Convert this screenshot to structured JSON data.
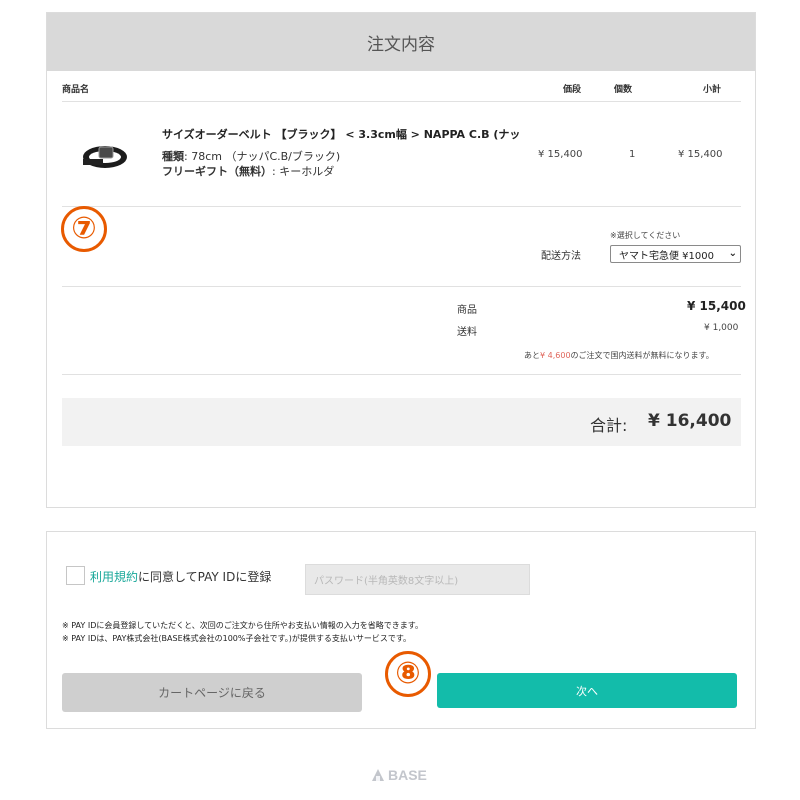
{
  "order": {
    "title": "注文内容",
    "columns": {
      "name": "商品名",
      "price": "価段",
      "qty": "個数",
      "subtotal": "小計"
    },
    "item": {
      "name": "サイズオーダーベルト 【ブラック】 < 3.3cm幅 > NAPPA C.B (ナッ",
      "option1_label": "種類",
      "option1_value": ": 78cm （ナッパC.B/ブラック)",
      "option2_label": "フリーギフト（無料）",
      "option2_value": ": キーホルダ",
      "price": "¥ 15,400",
      "qty": "1",
      "subtotal": "¥ 15,400"
    },
    "step7_marker": "⑦",
    "shipping": {
      "note": "※選択してください",
      "label": "配送方法",
      "selected": "ヤマト宅急便 ¥1000"
    },
    "summary": {
      "goods_label": "商品",
      "goods_value": "¥ 15,400",
      "shipping_label": "送料",
      "shipping_value": "¥ 1,000",
      "free_note_pre": "あと",
      "free_note_amount": "¥ 4,600",
      "free_note_post": "のご注文で国内送料が無料になります。"
    },
    "total_label": "合計:",
    "total_value": "¥ 16,400"
  },
  "register": {
    "terms_link": "利用規約",
    "agree_text": "に同意してPAY IDに登録",
    "password_placeholder": "パスワード(半角英数8文字以上)",
    "notice1": "※ PAY IDに会員登録していただくと、次回のご注文から住所やお支払い情報の入力を省略できます。",
    "notice2": "※ PAY IDは、PAY株式会社(BASE株式会社の100%子会社です。)が提供する支払いサービスです。",
    "back_label": "カートページに戻る",
    "next_label": "次へ",
    "step8_marker": "⑧"
  },
  "footer": {
    "brand": "BASE"
  },
  "colors": {
    "accent": "#13bcaa",
    "link": "#1aa89a",
    "marker": "#e85a00",
    "sale": "#e0675c"
  }
}
